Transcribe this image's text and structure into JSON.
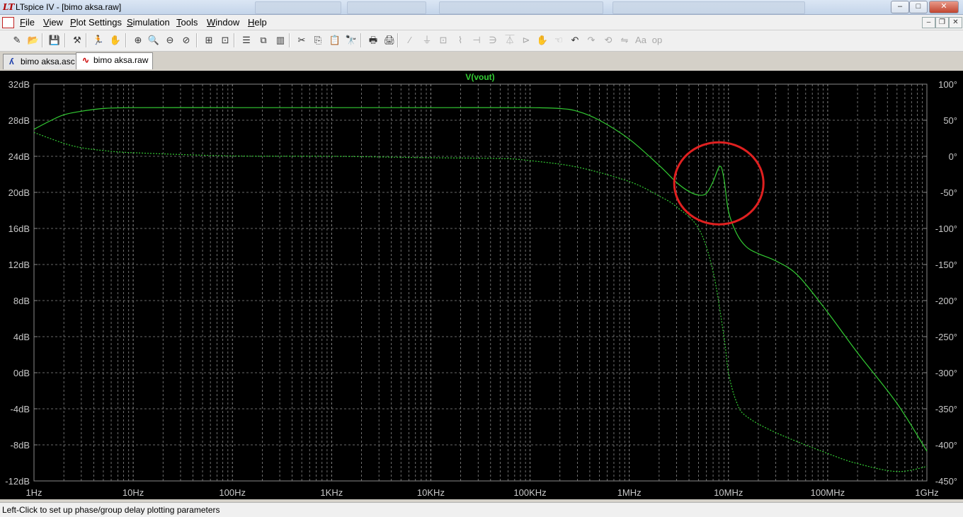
{
  "window": {
    "title": "LTspice IV - [bimo aksa.raw]",
    "app_icon": "ltspice-logo-icon"
  },
  "window_controls": {
    "minimize": "–",
    "maximize": "□",
    "close": "✕"
  },
  "menu": [
    "File",
    "View",
    "Plot Settings",
    "Simulation",
    "Tools",
    "Window",
    "Help"
  ],
  "mdi_controls": {
    "minimize": "–",
    "restore": "❐",
    "close": "✕"
  },
  "toolbar": [
    {
      "icon": "new-schematic-icon",
      "glyph": "✎"
    },
    {
      "icon": "open-file-icon",
      "glyph": "📂"
    },
    {
      "icon": "save-icon",
      "glyph": "💾"
    },
    {
      "icon": "control-panel-icon",
      "glyph": "⚒"
    },
    {
      "icon": "run-icon",
      "glyph": "🏃"
    },
    {
      "icon": "halt-hand-icon",
      "glyph": "✋"
    },
    {
      "icon": "zoom-in-icon",
      "glyph": "⊕"
    },
    {
      "icon": "zoom-pan-icon",
      "glyph": "🔍"
    },
    {
      "icon": "zoom-out-icon",
      "glyph": "⊖"
    },
    {
      "icon": "zoom-cancel-icon",
      "glyph": "⊘"
    },
    {
      "icon": "autorange-icon",
      "glyph": "⊞"
    },
    {
      "icon": "fit-icon",
      "glyph": "⊡"
    },
    {
      "icon": "tile-horizontal-icon",
      "glyph": "☰"
    },
    {
      "icon": "cascade-icon",
      "glyph": "⧉"
    },
    {
      "icon": "tile-vertical-icon",
      "glyph": "▥"
    },
    {
      "icon": "cut-icon",
      "glyph": "✂"
    },
    {
      "icon": "copy-icon",
      "glyph": "⎘"
    },
    {
      "icon": "paste-icon",
      "glyph": "📋"
    },
    {
      "icon": "find-icon",
      "glyph": "🔭"
    },
    {
      "icon": "print-preview-icon",
      "glyph": "🖶"
    },
    {
      "icon": "print-icon",
      "glyph": "🖨"
    },
    {
      "icon": "wire-icon",
      "glyph": "∕",
      "dim": true
    },
    {
      "icon": "ground-icon",
      "glyph": "⏚",
      "dim": true
    },
    {
      "icon": "label-net-icon",
      "glyph": "⊡",
      "dim": true
    },
    {
      "icon": "resistor-icon",
      "glyph": "⌇",
      "dim": true
    },
    {
      "icon": "capacitor-icon",
      "glyph": "⊣",
      "dim": true
    },
    {
      "icon": "inductor-icon",
      "glyph": "∋",
      "dim": true
    },
    {
      "icon": "diode-icon",
      "glyph": "⏄",
      "dim": true
    },
    {
      "icon": "component-icon",
      "glyph": "⊳",
      "dim": true
    },
    {
      "icon": "move-icon",
      "glyph": "✋",
      "dim": true
    },
    {
      "icon": "drag-icon",
      "glyph": "☜",
      "dim": true
    },
    {
      "icon": "undo-icon",
      "glyph": "↶"
    },
    {
      "icon": "redo-icon",
      "glyph": "↷",
      "dim": true
    },
    {
      "icon": "rotate-icon",
      "glyph": "⟲",
      "dim": true
    },
    {
      "icon": "mirror-icon",
      "glyph": "⇋",
      "dim": true
    },
    {
      "icon": "text-icon",
      "glyph": "Aa",
      "dim": true
    },
    {
      "icon": "spice-directive-icon",
      "glyph": "op",
      "dim": true
    }
  ],
  "tabs": [
    {
      "label": "bimo aksa.asc",
      "icon": "schematic-icon",
      "active": false
    },
    {
      "label": "bimo aksa.raw",
      "icon": "waveform-icon",
      "active": true
    }
  ],
  "status": "Left-Click to set up phase/group delay plotting parameters",
  "colors": {
    "trace": "#33cc33",
    "grid": "#8a8a8a",
    "highlight_circle": "#e02020",
    "background": "#000000"
  },
  "chart_data": {
    "type": "line",
    "title": "V(vout)",
    "x_scale": "log",
    "xlim": [
      1,
      1000000000
    ],
    "x_ticks": [
      "1Hz",
      "10Hz",
      "100Hz",
      "1KHz",
      "10KHz",
      "100KHz",
      "1MHz",
      "10MHz",
      "100MHz",
      "1GHz"
    ],
    "y_left": {
      "ylim": [
        -12,
        32
      ],
      "ticks": [
        "32dB",
        "28dB",
        "24dB",
        "20dB",
        "16dB",
        "12dB",
        "8dB",
        "4dB",
        "0dB",
        "-4dB",
        "-8dB",
        "-12dB"
      ]
    },
    "y_right": {
      "ylim": [
        -450,
        100
      ],
      "ticks": [
        "100°",
        "50°",
        "0°",
        "-50°",
        "-100°",
        "-150°",
        "-200°",
        "-250°",
        "-300°",
        "-350°",
        "-400°",
        "-450°"
      ]
    },
    "grid": true,
    "series": [
      {
        "axis": "left",
        "style": "solid",
        "points": [
          [
            1,
            27.0
          ],
          [
            1.5,
            28.0
          ],
          [
            2,
            28.6
          ],
          [
            3,
            29.0
          ],
          [
            5,
            29.3
          ],
          [
            10,
            29.4
          ],
          [
            100,
            29.4
          ],
          [
            1000,
            29.4
          ],
          [
            10000,
            29.4
          ],
          [
            100000,
            29.4
          ],
          [
            200000,
            29.3
          ],
          [
            300000,
            29.0
          ],
          [
            500000,
            28.0
          ],
          [
            1000000,
            25.9
          ],
          [
            2000000,
            23.0
          ],
          [
            3000000,
            21.1
          ],
          [
            4000000,
            20.1
          ],
          [
            5000000,
            19.7
          ],
          [
            6000000,
            19.9
          ],
          [
            7000000,
            21.2
          ],
          [
            8200000,
            22.9
          ],
          [
            9000000,
            21.5
          ],
          [
            10000000,
            17.9
          ],
          [
            12000000,
            15.5
          ],
          [
            15000000,
            14.0
          ],
          [
            20000000,
            13.2
          ],
          [
            30000000,
            12.4
          ],
          [
            50000000,
            10.8
          ],
          [
            100000000,
            6.7
          ],
          [
            200000000,
            2.2
          ],
          [
            500000000,
            -3.4
          ],
          [
            1000000000,
            -8.7
          ]
        ]
      },
      {
        "axis": "right",
        "style": "dashed",
        "points": [
          [
            1,
            33
          ],
          [
            2,
            18
          ],
          [
            3,
            12
          ],
          [
            5,
            8
          ],
          [
            10,
            5
          ],
          [
            100,
            0.5
          ],
          [
            1000,
            0
          ],
          [
            10000,
            -2
          ],
          [
            50000,
            -3
          ],
          [
            100000,
            -6
          ],
          [
            300000,
            -15
          ],
          [
            1000000,
            -35
          ],
          [
            2000000,
            -55
          ],
          [
            3000000,
            -70
          ],
          [
            5000000,
            -100
          ],
          [
            7000000,
            -160
          ],
          [
            9000000,
            -250
          ],
          [
            10000000,
            -300
          ],
          [
            12000000,
            -340
          ],
          [
            15000000,
            -360
          ],
          [
            30000000,
            -383
          ],
          [
            100000000,
            -412
          ],
          [
            200000000,
            -426
          ],
          [
            500000000,
            -437
          ],
          [
            1000000000,
            -430
          ]
        ]
      }
    ],
    "annotations": [
      {
        "shape": "circle",
        "center": [
          8000000,
          21.0
        ],
        "color": "red"
      }
    ]
  }
}
